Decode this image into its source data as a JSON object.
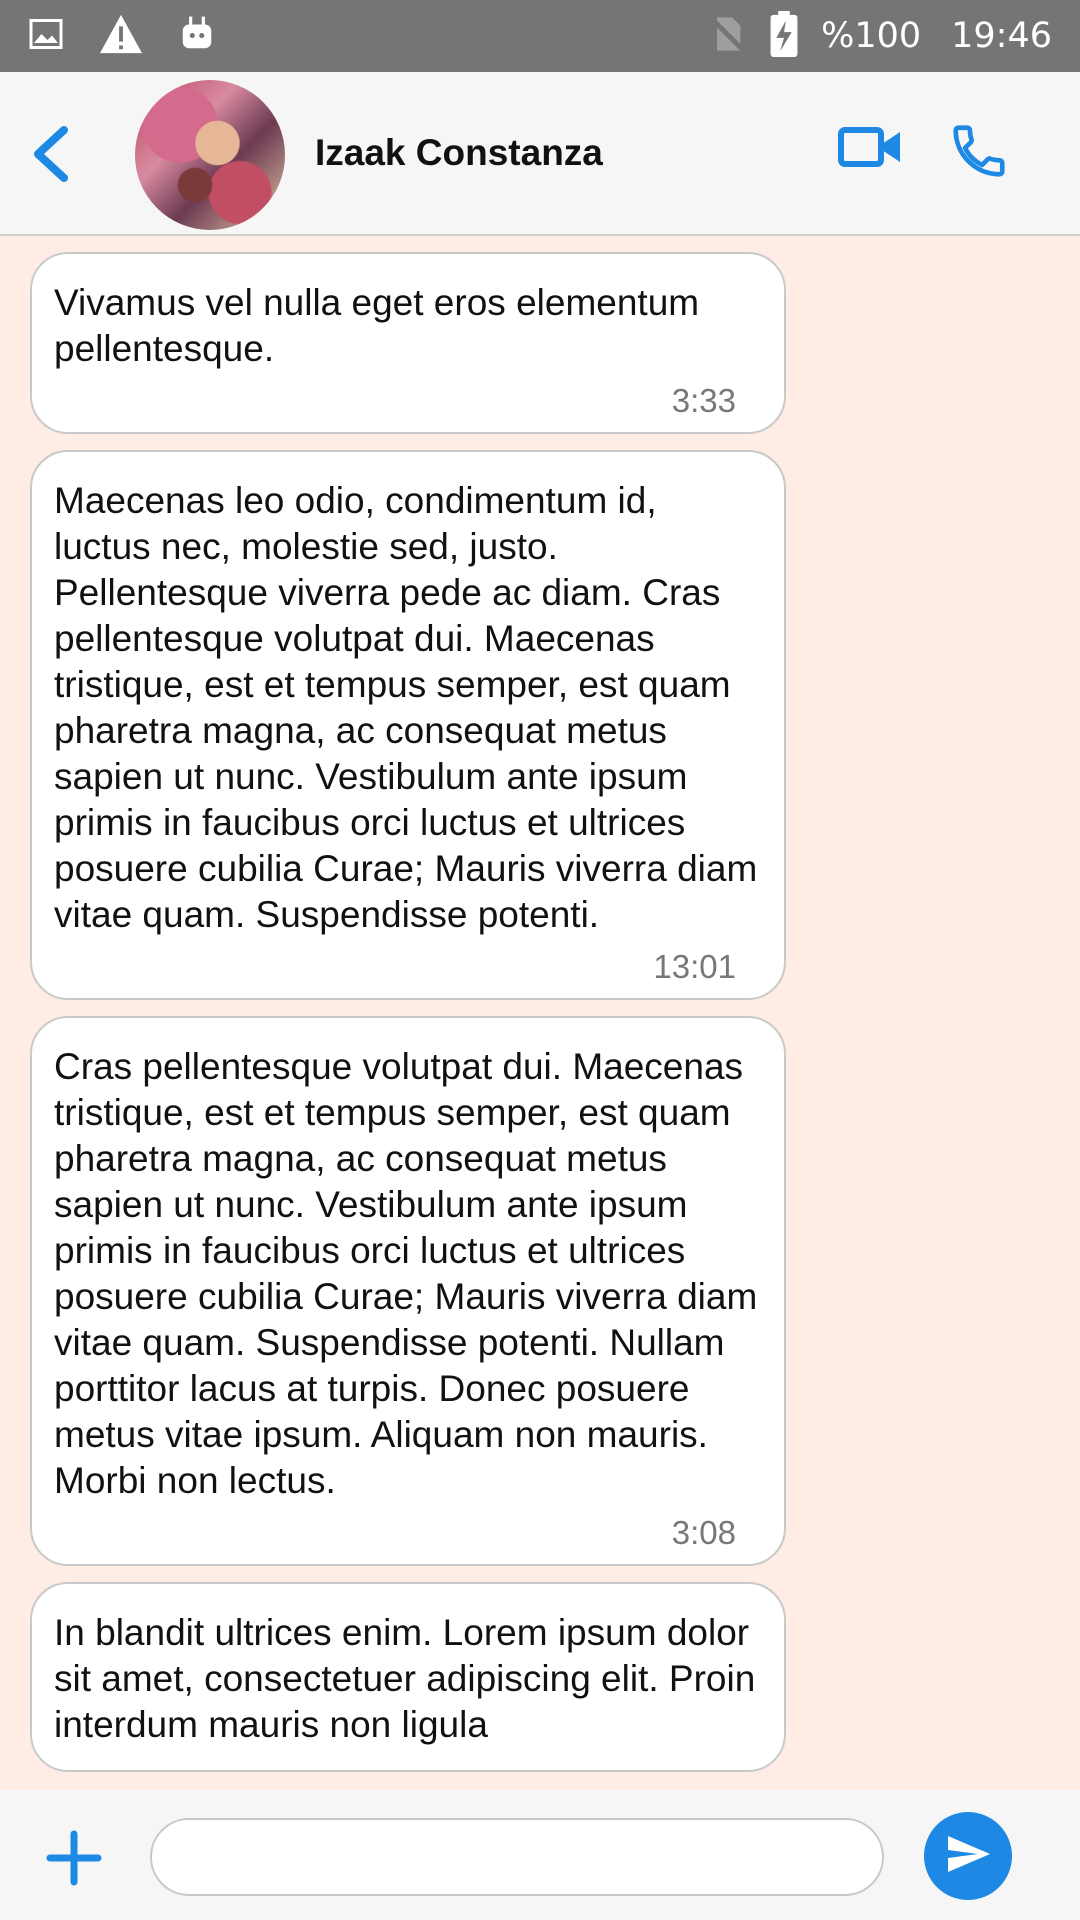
{
  "status_bar": {
    "battery": "%100",
    "time": "19:46",
    "icons": [
      "image-icon",
      "warning-icon",
      "android-icon",
      "no-sim-icon",
      "battery-charging-icon"
    ]
  },
  "header": {
    "contact_name": "Izaak Constanza",
    "icons": [
      "back-arrow-icon",
      "video-camera-icon",
      "phone-icon"
    ],
    "accent_color": "#1e88e5"
  },
  "messages": [
    {
      "text": "Vivamus vel nulla eget eros elementum pellentesque.",
      "time": "3:33"
    },
    {
      "text": "Maecenas leo odio, condimentum id, luctus nec, molestie sed, justo. Pellentesque viverra pede ac diam. Cras pellentesque volutpat dui. Maecenas tristique, est et tempus semper, est quam pharetra magna, ac consequat metus sapien ut nunc. Vestibulum ante ipsum primis in faucibus orci luctus et ultrices posuere cubilia Curae; Mauris viverra diam vitae quam. Suspendisse potenti.",
      "time": "13:01"
    },
    {
      "text": "Cras pellentesque volutpat dui. Maecenas tristique, est et tempus semper, est quam pharetra magna, ac consequat metus sapien ut nunc. Vestibulum ante ipsum primis in faucibus orci luctus et ultrices posuere cubilia Curae; Mauris viverra diam vitae quam. Suspendisse potenti. Nullam porttitor lacus at turpis. Donec posuere metus vitae ipsum. Aliquam non mauris. Morbi non lectus.",
      "time": "3:08"
    },
    {
      "text": "In blandit ultrices enim. Lorem ipsum dolor sit amet, consectetuer adipiscing elit. Proin interdum mauris non ligula",
      "time": ""
    }
  ],
  "composer": {
    "value": "",
    "placeholder": "",
    "icons": [
      "plus-icon",
      "send-icon"
    ]
  },
  "colors": {
    "chat_background": "#ffece5",
    "status_bar": "#757575",
    "accent": "#1e88e5"
  }
}
